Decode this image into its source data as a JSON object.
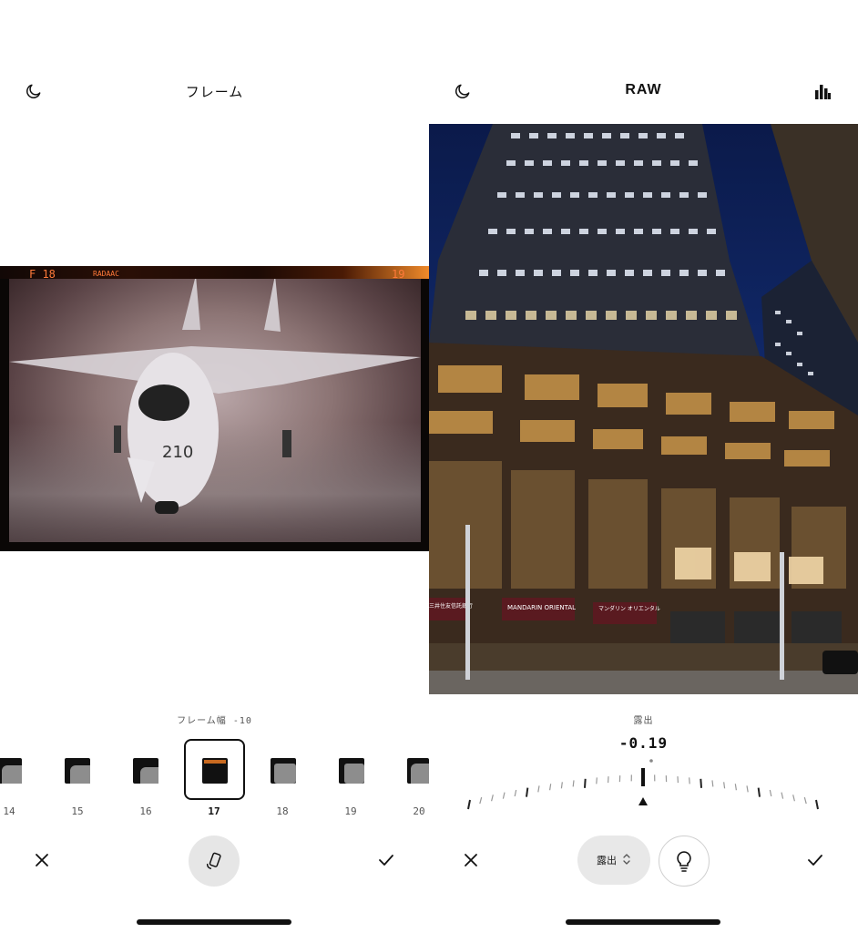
{
  "left_panel": {
    "title": "フレーム",
    "frame_readout": {
      "left": "F 18",
      "code": "RADAAC",
      "right": "19"
    },
    "slider_label": "フレーム幅 -10",
    "thumbnails": [
      "14",
      "15",
      "16",
      "17",
      "18",
      "19",
      "20"
    ],
    "selected_thumbnail": "17"
  },
  "right_panel": {
    "title": "RAW",
    "slider_label": "露出",
    "value": "-0.19",
    "mode_button_label": "露出",
    "signs": {
      "hotel_en": "MANDARIN ORIENTAL",
      "hotel_jp": "マンダリン オリエンタル",
      "bank_jp": "三井住友信託銀行"
    }
  },
  "icons": {
    "moon": "moon-icon",
    "histogram": "bar-chart-icon",
    "close": "close-icon",
    "check": "check-icon",
    "rotate": "rotate-phone-icon",
    "bulb": "lightbulb-icon",
    "chevron": "up-down-chevron-icon"
  },
  "colors": {
    "accent_text": "#111111",
    "frame_orange": "#ff7a3a",
    "pill_bg": "#e8e8e8"
  }
}
